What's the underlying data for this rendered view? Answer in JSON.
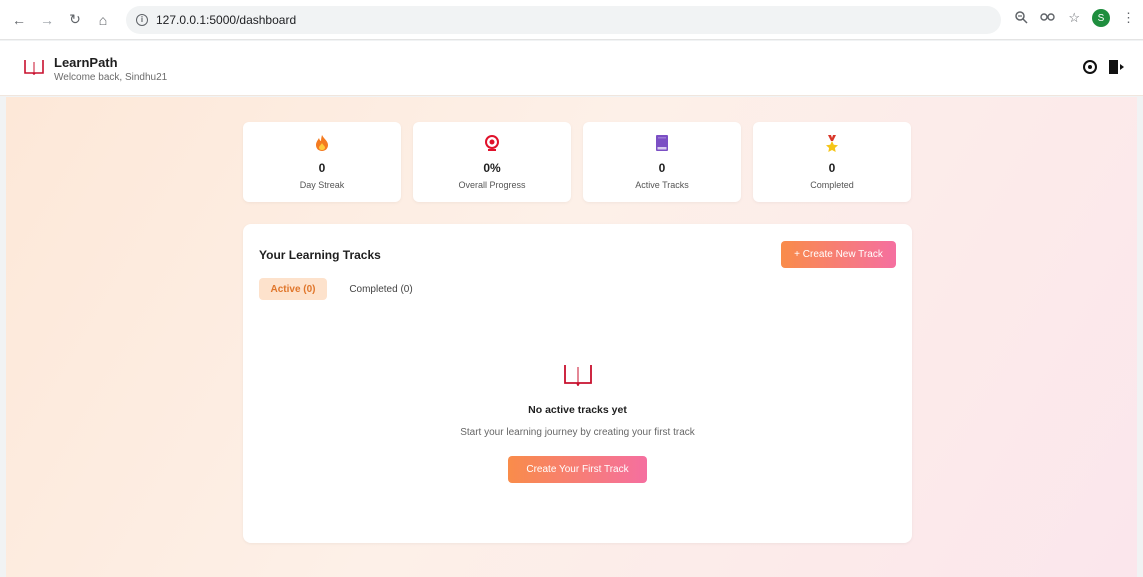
{
  "browser": {
    "url": "127.0.0.1:5000/dashboard",
    "profile_initial": "S"
  },
  "app": {
    "title": "LearnPath",
    "subtitle": "Welcome back, Sindhu21"
  },
  "stats": [
    {
      "icon": "fire-icon",
      "value": "0",
      "label": "Day Streak"
    },
    {
      "icon": "target-icon",
      "value": "0%",
      "label": "Overall Progress"
    },
    {
      "icon": "book-icon",
      "value": "0",
      "label": "Active Tracks"
    },
    {
      "icon": "medal-icon",
      "value": "0",
      "label": "Completed"
    }
  ],
  "tracks": {
    "title": "Your Learning Tracks",
    "create_button": "+ Create New Track",
    "tabs": [
      {
        "label": "Active (0)"
      },
      {
        "label": "Completed (0)"
      }
    ],
    "empty": {
      "title": "No active tracks yet",
      "description": "Start your learning journey by creating your first track",
      "button": "Create Your First Track"
    }
  },
  "colors": {
    "accent_gradient_start": "#f98c4a",
    "accent_gradient_end": "#f56fa0",
    "active_tab_bg": "#fde2cc",
    "logo_red": "#c8102e"
  }
}
